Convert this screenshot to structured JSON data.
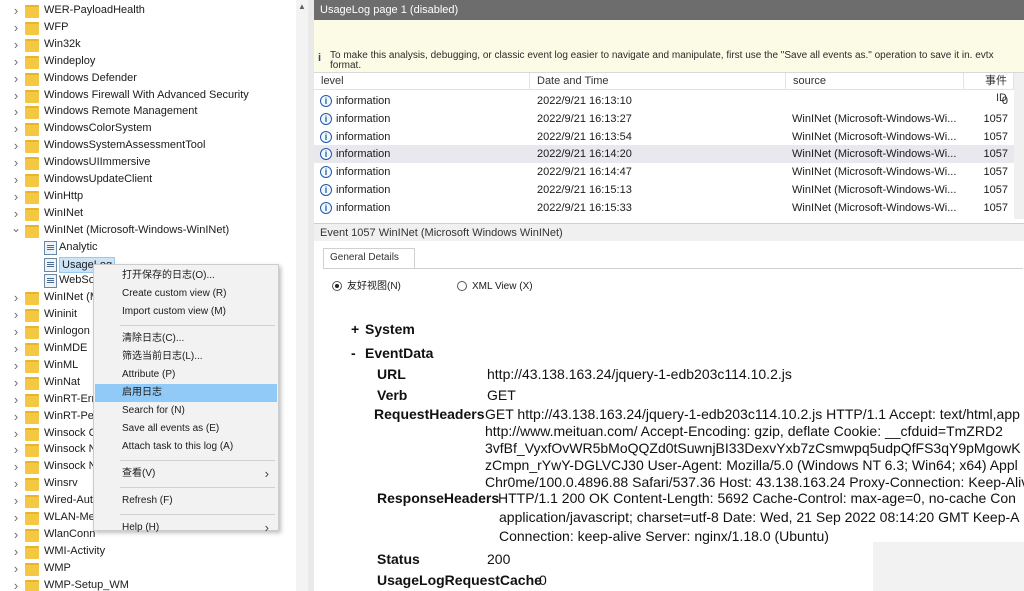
{
  "tree": {
    "items": [
      {
        "label": "WER-PayloadHealth",
        "type": "folder",
        "expand": "collapsed"
      },
      {
        "label": "WFP",
        "type": "folder",
        "expand": "collapsed"
      },
      {
        "label": "Win32k",
        "type": "folder",
        "expand": "collapsed"
      },
      {
        "label": "Windeploy",
        "type": "folder",
        "expand": "collapsed"
      },
      {
        "label": "Windows Defender",
        "type": "folder",
        "expand": "collapsed"
      },
      {
        "label": "Windows Firewall With Advanced Security",
        "type": "folder",
        "expand": "collapsed"
      },
      {
        "label": "Windows Remote Management",
        "type": "folder",
        "expand": "collapsed"
      },
      {
        "label": "WindowsColorSystem",
        "type": "folder",
        "expand": "collapsed"
      },
      {
        "label": "WindowsSystemAssessmentTool",
        "type": "folder",
        "expand": "collapsed"
      },
      {
        "label": "WindowsUIImmersive",
        "type": "folder",
        "expand": "collapsed"
      },
      {
        "label": "WindowsUpdateClient",
        "type": "folder",
        "expand": "collapsed"
      },
      {
        "label": "WinHttp",
        "type": "folder",
        "expand": "collapsed"
      },
      {
        "label": "WinINet",
        "type": "folder",
        "expand": "collapsed"
      },
      {
        "label": "WinINet (Microsoft-Windows-WinINet)",
        "type": "folder",
        "expand": "expanded"
      },
      {
        "label": "Analytic",
        "type": "log",
        "expand": "none"
      },
      {
        "label": "UsageLog",
        "type": "log",
        "expand": "none",
        "selected": true
      },
      {
        "label": "WebSo",
        "type": "log",
        "expand": "none"
      },
      {
        "label": "WinINet (M",
        "type": "folder",
        "expand": "collapsed"
      },
      {
        "label": "Wininit",
        "type": "folder",
        "expand": "collapsed"
      },
      {
        "label": "Winlogon",
        "type": "folder",
        "expand": "collapsed"
      },
      {
        "label": "WinMDE",
        "type": "folder",
        "expand": "collapsed"
      },
      {
        "label": "WinML",
        "type": "folder",
        "expand": "collapsed"
      },
      {
        "label": "WinNat",
        "type": "folder",
        "expand": "collapsed"
      },
      {
        "label": "WinRT-Err",
        "type": "folder",
        "expand": "collapsed"
      },
      {
        "label": "WinRT-Per",
        "type": "folder",
        "expand": "collapsed"
      },
      {
        "label": "Winsock C",
        "type": "folder",
        "expand": "collapsed"
      },
      {
        "label": "Winsock N",
        "type": "folder",
        "expand": "collapsed"
      },
      {
        "label": "Winsock N",
        "type": "folder",
        "expand": "collapsed"
      },
      {
        "label": "Winsrv",
        "type": "folder",
        "expand": "collapsed"
      },
      {
        "label": "Wired-Aut",
        "type": "folder",
        "expand": "collapsed"
      },
      {
        "label": "WLAN-Me",
        "type": "folder",
        "expand": "collapsed"
      },
      {
        "label": "WlanConn",
        "type": "folder",
        "expand": "collapsed"
      },
      {
        "label": "WMI-Activity",
        "type": "folder",
        "expand": "collapsed"
      },
      {
        "label": "WMP",
        "type": "folder",
        "expand": "collapsed"
      },
      {
        "label": "WMP-Setup_WM",
        "type": "folder",
        "expand": "collapsed"
      }
    ]
  },
  "context_menu": {
    "items": [
      {
        "label": "打开保存的日志(O)...",
        "enabled": true
      },
      {
        "label": "Create custom view (R)",
        "enabled": true
      },
      {
        "label": "Import custom view (M)",
        "enabled": true
      },
      {
        "sep": true
      },
      {
        "label": "清除日志(C)...",
        "enabled": true
      },
      {
        "label": "筛选当前日志(L)...",
        "enabled": true
      },
      {
        "label": "Attribute (P)",
        "enabled": true
      },
      {
        "label": "启用日志",
        "enabled": true,
        "highlighted": true
      },
      {
        "label": "Search for (N)",
        "enabled": true
      },
      {
        "label": "Save all events as (E)",
        "enabled": true
      },
      {
        "label": "Attach task to this log (A)",
        "enabled": true
      },
      {
        "sep": true
      },
      {
        "label": "查看(V)",
        "enabled": true,
        "submenu": true
      },
      {
        "sep": true
      },
      {
        "label": "Refresh (F)",
        "enabled": true
      },
      {
        "sep": true
      },
      {
        "label": "Help (H)",
        "enabled": true,
        "submenu": true
      }
    ]
  },
  "log_pane": {
    "title": "UsageLog page 1 (disabled)",
    "info_message": "To make this analysis, debugging, or classic event log easier to navigate and manipulate, first use the \"Save all events as.\" operation to save it in. evtx format.",
    "columns": {
      "level": "level",
      "date": "Date and Time",
      "source": "source",
      "event_id": "事件 ID"
    },
    "rows": [
      {
        "level": "information",
        "date": "2022/9/21 16:13:10",
        "source": "",
        "event_id": "0"
      },
      {
        "level": "information",
        "date": "2022/9/21 16:13:27",
        "source": "WinINet (Microsoft-Windows-Wi...",
        "event_id": "1057"
      },
      {
        "level": "information",
        "date": "2022/9/21 16:13:54",
        "source": "WinINet (Microsoft-Windows-Wi...",
        "event_id": "1057"
      },
      {
        "level": "information",
        "date": "2022/9/21 16:14:20",
        "source": "WinINet (Microsoft-Windows-Wi...",
        "event_id": "1057",
        "selected": true
      },
      {
        "level": "information",
        "date": "2022/9/21 16:14:47",
        "source": "WinINet (Microsoft-Windows-Wi...",
        "event_id": "1057"
      },
      {
        "level": "information",
        "date": "2022/9/21 16:15:13",
        "source": "WinINet (Microsoft-Windows-Wi...",
        "event_id": "1057"
      },
      {
        "level": "information",
        "date": "2022/9/21 16:15:33",
        "source": "WinINet (Microsoft-Windows-Wi...",
        "event_id": "1057"
      }
    ]
  },
  "event_pane": {
    "title": "Event 1057 WinINet (Microsoft Windows WinINet)",
    "tab_label": "General Details",
    "radio_friendly": "友好视图(N)",
    "radio_xml": "XML View (X)",
    "system_label": "System",
    "eventdata_label": "EventData",
    "toggle_plus": "+",
    "toggle_minus": "-",
    "fields": {
      "url_key": "URL",
      "url_val": "http://43.138.163.24/jquery-1-edb203c114.10.2.js",
      "verb_key": "Verb",
      "verb_val": "GET",
      "reqh_key": "RequestHeaders",
      "reqh_lines": [
        "GET http://43.138.163.24/jquery-1-edb203c114.10.2.js HTTP/1.1 Accept: text/html,app",
        "http://www.meituan.com/ Accept-Encoding: gzip, deflate Cookie: __cfduid=TmZRD2",
        "3vfBf_VyxfOvWR5bMoQQZd0tSuwnjBI33DexvYxb7zCsmwpq5udpQfFS3qY9pMgowK",
        "zCmpn_rYwY-DGLVCJ30 User-Agent: Mozilla/5.0 (Windows NT 6.3; Win64; x64) Appl",
        "Chr0me/100.0.4896.88 Safari/537.36 Host: 43.138.163.24 Proxy-Connection: Keep-Aliv"
      ],
      "resh_key": "ResponseHeaders",
      "resh_lines": [
        "HTTP/1.1 200 OK Content-Length: 5692 Cache-Control: max-age=0, no-cache Con",
        "application/javascript; charset=utf-8 Date: Wed, 21 Sep 2022 08:14:20 GMT Keep-A",
        "Connection: keep-alive Server: nginx/1.18.0 (Ubuntu)"
      ],
      "status_key": "Status",
      "status_val": "200",
      "cache_key": "UsageLogRequestCache",
      "cache_val": "0"
    }
  },
  "colors": {
    "title_bar": "#6d6d6d",
    "info_bar": "#fbfbe6",
    "menu_highlight": "#91c9f7",
    "folder": "#f4c842"
  },
  "icons": {
    "folder": "folder-icon",
    "log": "event-log-icon",
    "info": "information-icon",
    "chevron_right": "chevron-right-icon",
    "chevron_down": "chevron-down-icon"
  }
}
